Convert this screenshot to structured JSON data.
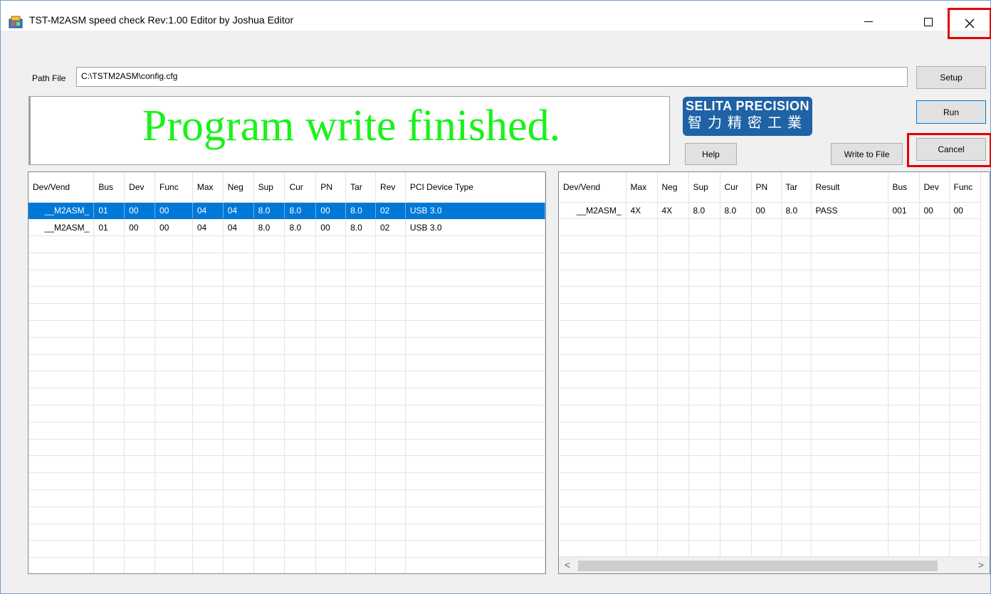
{
  "window": {
    "title": "TST-M2ASM speed  check Rev:1.00 Editor by Joshua Editor",
    "minimize_glyph": "—",
    "maximize_glyph": "☐",
    "close_glyph": "✕"
  },
  "path": {
    "label": "Path File",
    "value": "C:\\TSTM2ASM\\config.cfg"
  },
  "buttons": {
    "setup": "Setup",
    "run": "Run",
    "cancel": "Cancel",
    "help": "Help",
    "write": "Write to File"
  },
  "message": "Program write finished.",
  "logo": {
    "english": "SELITA PRECISION",
    "chinese": "智力精密工業"
  },
  "colors": {
    "message_text": "#19f219",
    "selection": "#0078d7",
    "highlight_frame": "#e00000",
    "logo_bg": "#1f63a6"
  },
  "left_table": {
    "columns": [
      "Dev/Vend",
      "Bus",
      "Dev",
      "Func",
      "Max",
      "Neg",
      "Sup",
      "Cur",
      "PN",
      "Tar",
      "Rev",
      "PCI Device Type"
    ],
    "rows": [
      [
        "__M2ASM_",
        "01",
        "00",
        "00",
        "04",
        "04",
        "8.0",
        "8.0",
        "00",
        "8.0",
        "02",
        "USB 3.0"
      ],
      [
        "__M2ASM_",
        "01",
        "00",
        "00",
        "04",
        "04",
        "8.0",
        "8.0",
        "00",
        "8.0",
        "02",
        "USB 3.0"
      ]
    ],
    "selected_row": 0
  },
  "right_table": {
    "columns": [
      "Dev/Vend",
      "Max",
      "Neg",
      "Sup",
      "Cur",
      "PN",
      "Tar",
      "Result",
      "Bus",
      "Dev",
      "Func"
    ],
    "rows": [
      [
        "__M2ASM_",
        "4X",
        "4X",
        "8.0",
        "8.0",
        "00",
        "8.0",
        "PASS",
        "001",
        "00",
        "00"
      ]
    ]
  },
  "scrollbar": {
    "left_arrow": "<",
    "right_arrow": ">"
  }
}
